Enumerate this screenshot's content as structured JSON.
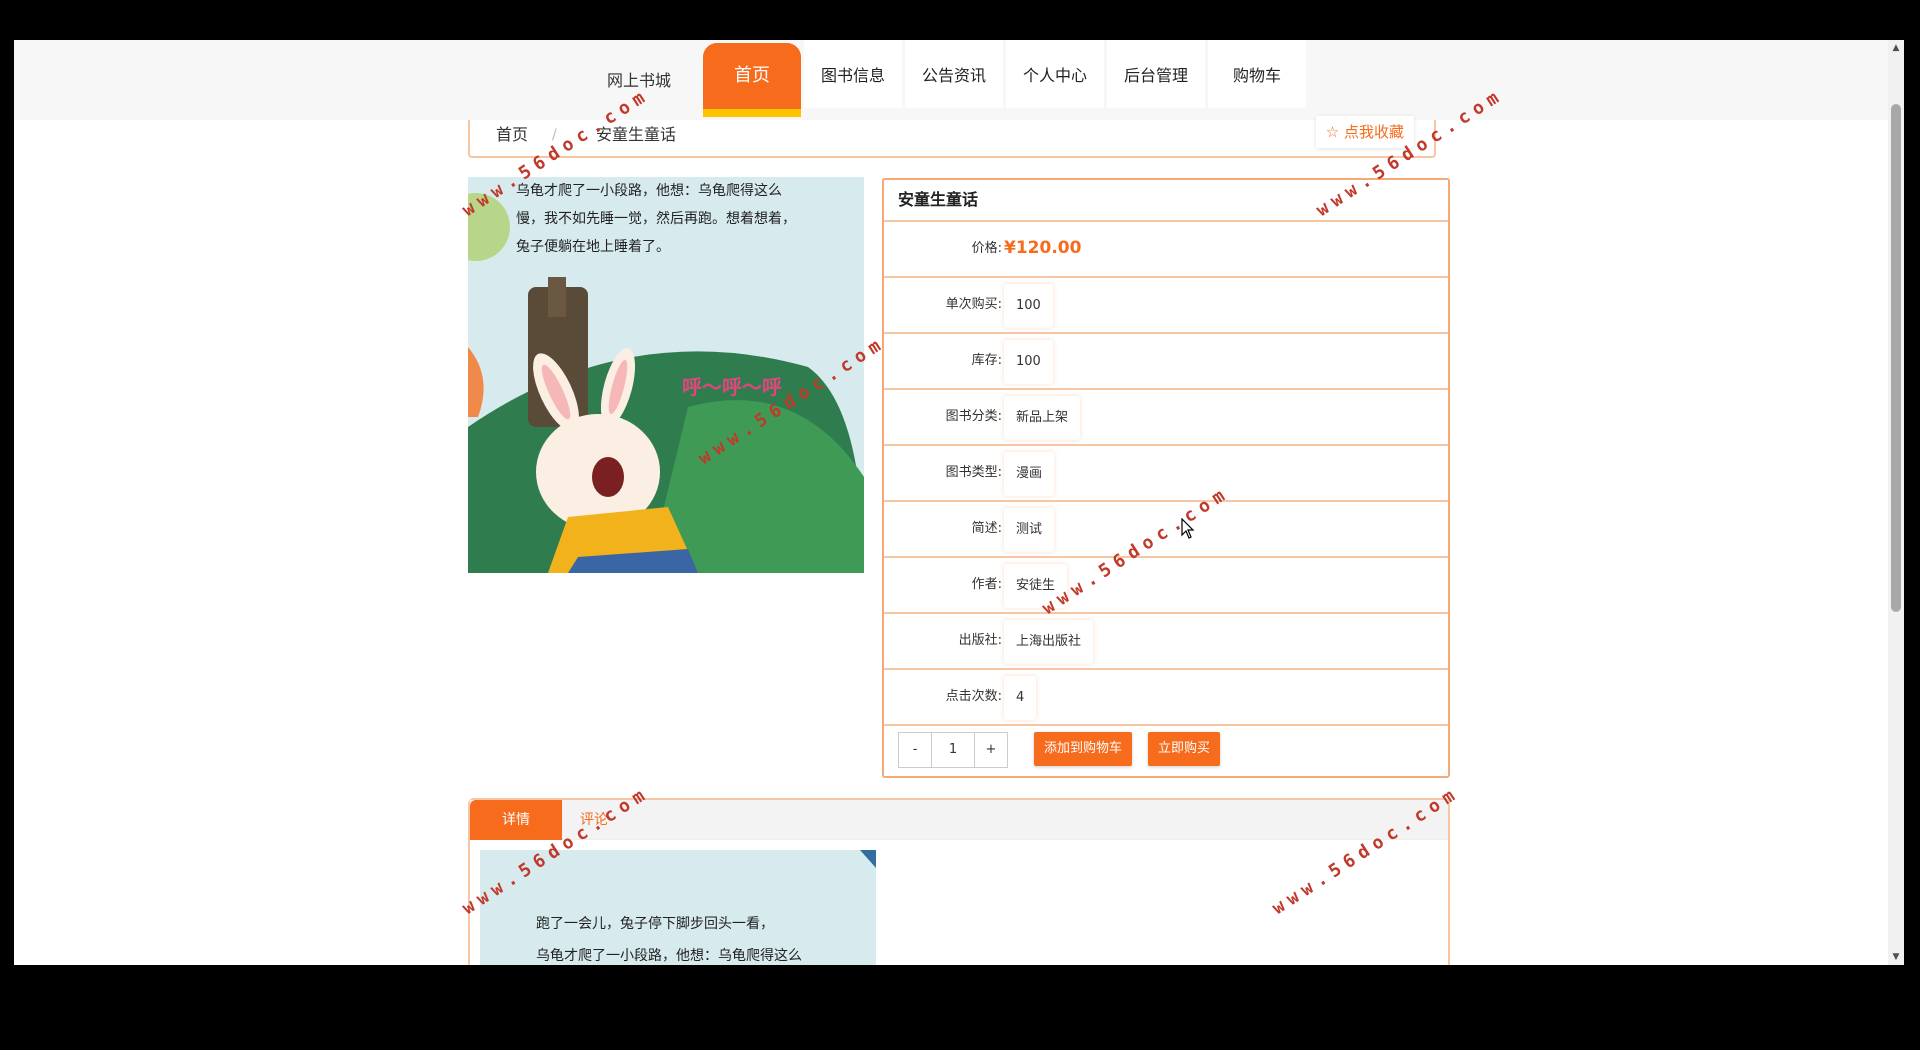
{
  "header": {
    "site_title": "网上书城",
    "nav": [
      "首页",
      "图书信息",
      "公告资讯",
      "个人中心",
      "后台管理",
      "购物车"
    ],
    "active_index": 0
  },
  "breadcrumb": {
    "home": "首页",
    "separator": "/",
    "current": "安童生童话",
    "favorite_label": "点我收藏",
    "favorite_icon": "star-outline-icon"
  },
  "cover": {
    "text_lines": [
      "乌龟才爬了一小段路，他想：乌龟爬得这么",
      "慢，我不如先睡一觉，然后再跑。想着想着，",
      "兔子便躺在地上睡着了。"
    ],
    "sound_text": "呼～呼～呼"
  },
  "book": {
    "title": "安童生童话",
    "price_label": "价格:",
    "price": "¥120.00",
    "fields": [
      {
        "label": "单次购买:",
        "value": "100"
      },
      {
        "label": "库存:",
        "value": "100"
      },
      {
        "label": "图书分类:",
        "value": "新品上架"
      },
      {
        "label": "图书类型:",
        "value": "漫画"
      },
      {
        "label": "简述:",
        "value": "测试"
      },
      {
        "label": "作者:",
        "value": "安徒生"
      },
      {
        "label": "出版社:",
        "value": "上海出版社"
      },
      {
        "label": "点击次数:",
        "value": "4"
      }
    ]
  },
  "actions": {
    "minus": "-",
    "quantity": "1",
    "plus": "+",
    "add_to_cart": "添加到购物车",
    "buy_now": "立即购买"
  },
  "tabs": {
    "detail": "详情",
    "comments": "评论"
  },
  "detail_image": {
    "text_lines": [
      "跑了一会儿，兔子停下脚步回头一看，",
      "乌龟才爬了一小段路，他想：乌龟爬得这么"
    ]
  },
  "watermark": "www.56doc.com",
  "colors": {
    "accent": "#f76b1c",
    "accent_border": "#f7c7a3",
    "nav_underline": "#ffc400",
    "watermark": "#c0392b"
  }
}
